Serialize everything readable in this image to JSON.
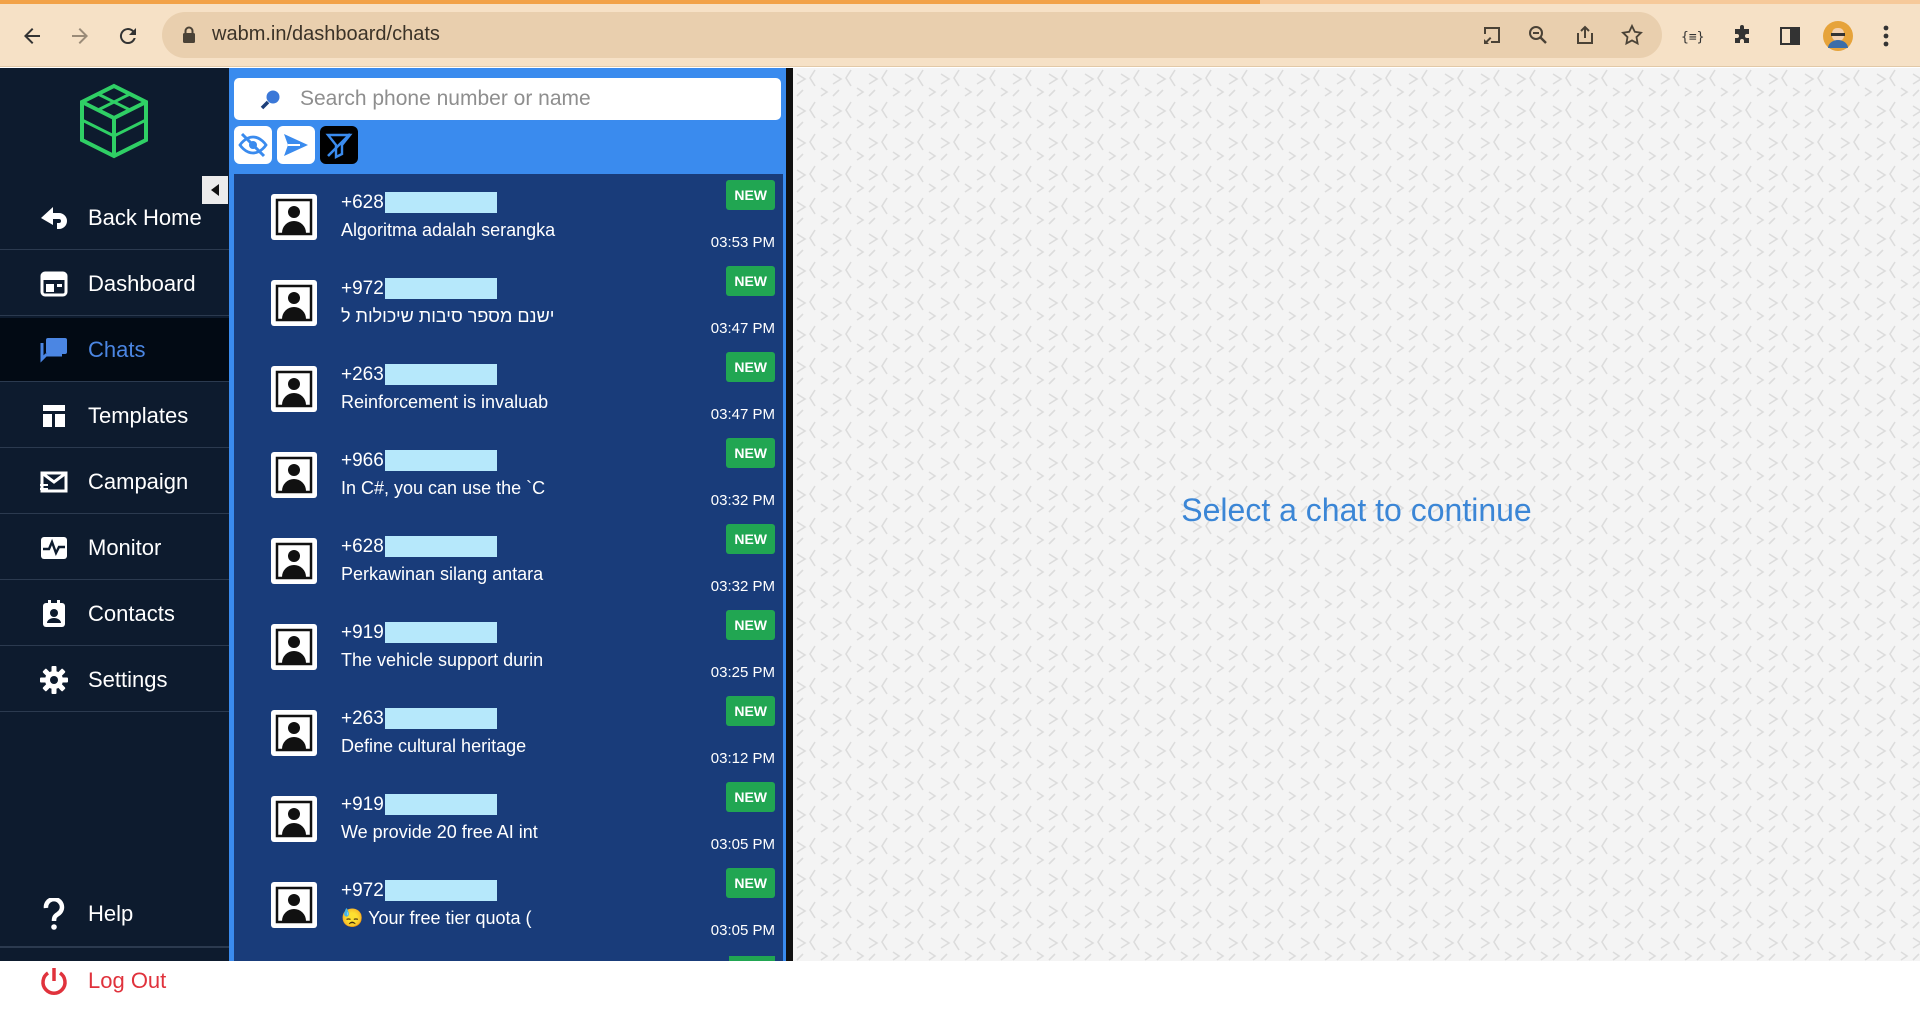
{
  "browser": {
    "url": "wabm.in/dashboard/chats"
  },
  "sidebar": {
    "items": [
      {
        "label": "Back Home",
        "icon": "back-home-icon"
      },
      {
        "label": "Dashboard",
        "icon": "dashboard-icon"
      },
      {
        "label": "Chats",
        "icon": "chats-icon",
        "active": true
      },
      {
        "label": "Templates",
        "icon": "templates-icon"
      },
      {
        "label": "Campaign",
        "icon": "campaign-icon"
      },
      {
        "label": "Monitor",
        "icon": "monitor-icon"
      },
      {
        "label": "Contacts",
        "icon": "contacts-icon"
      },
      {
        "label": "Settings",
        "icon": "settings-icon"
      }
    ],
    "help_label": "Help",
    "logout_label": "Log Out"
  },
  "search": {
    "placeholder": "Search phone number or name"
  },
  "chats": [
    {
      "phone": "+628",
      "message": "Algoritma adalah serangka",
      "badge": "NEW",
      "time": "03:53 PM"
    },
    {
      "phone": "+972",
      "message": "ישנם מספר סיבות שיכולות ל",
      "badge": "NEW",
      "time": "03:47 PM"
    },
    {
      "phone": "+263",
      "message": "Reinforcement is invaluab",
      "badge": "NEW",
      "time": "03:47 PM"
    },
    {
      "phone": "+966",
      "message": "In C#, you can use the `C",
      "badge": "NEW",
      "time": "03:32 PM"
    },
    {
      "phone": "+628",
      "message": "Perkawinan silang antara",
      "badge": "NEW",
      "time": "03:32 PM"
    },
    {
      "phone": "+919",
      "message": "The vehicle support durin",
      "badge": "NEW",
      "time": "03:25 PM"
    },
    {
      "phone": "+263",
      "message": "Define cultural heritage",
      "badge": "NEW",
      "time": "03:12 PM"
    },
    {
      "phone": "+919",
      "message": "We provide 20 free AI int",
      "badge": "NEW",
      "time": "03:05 PM"
    },
    {
      "phone": "+972",
      "message": "😓 Your free tier quota (",
      "badge": "NEW",
      "time": "03:05 PM"
    }
  ],
  "main": {
    "placeholder_text": "Select a chat to continue"
  },
  "colors": {
    "sidebar_bg": "#0d1b2e",
    "active_nav": "#4b86e3",
    "chat_panel": "#3a8bee",
    "chat_list_bg": "#193c7a",
    "badge_green": "#21a652",
    "logout_red": "#e0323c"
  }
}
